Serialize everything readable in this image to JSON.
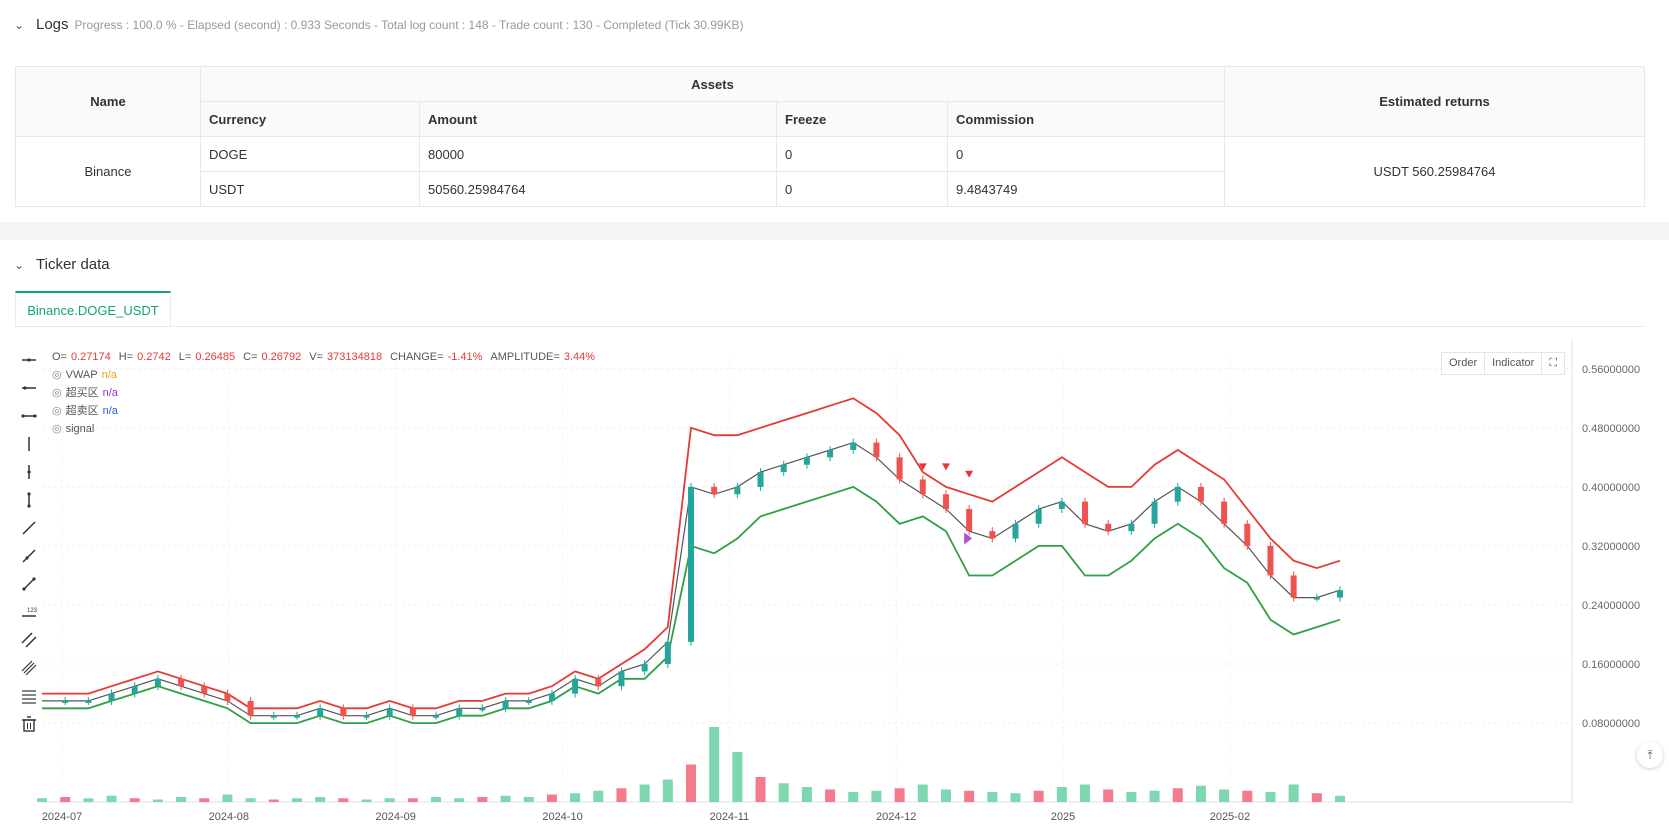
{
  "logs": {
    "title": "Logs",
    "meta": "Progress : 100.0 % - Elapsed (second) : 0.933   Seconds - Total log count : 148 - Trade count : 130 - Completed (Tick 30.99KB)"
  },
  "assets_table": {
    "name_header": "Name",
    "assets_header": "Assets",
    "returns_header": "Estimated returns",
    "columns": [
      "Currency",
      "Amount",
      "Freeze",
      "Commission"
    ],
    "exchange": "Binance",
    "rows": [
      {
        "currency": "DOGE",
        "amount": "80000",
        "freeze": "0",
        "commission": "0"
      },
      {
        "currency": "USDT",
        "amount": "50560.25984764",
        "freeze": "0",
        "commission": "9.4843749"
      }
    ],
    "estimated_returns": "USDT 560.25984764"
  },
  "ticker": {
    "title": "Ticker data",
    "tab": "Binance.DOGE_USDT"
  },
  "legend": {
    "ohlc": [
      {
        "label": "O=",
        "value": "0.27174"
      },
      {
        "label": "H=",
        "value": "0.2742"
      },
      {
        "label": "L=",
        "value": "0.26485"
      },
      {
        "label": "C=",
        "value": "0.26792"
      },
      {
        "label": "V=",
        "value": "373134818"
      },
      {
        "label": "CHANGE=",
        "value": "-1.41%"
      },
      {
        "label": "AMPLITUDE=",
        "value": "3.44%"
      }
    ],
    "indicators": [
      {
        "name": "VWAP",
        "value": "n/a",
        "color": "#f59e0b"
      },
      {
        "name": "超买区",
        "value": "n/a",
        "color": "#9333ea"
      },
      {
        "name": "超卖区",
        "value": "n/a",
        "color": "#2563eb"
      },
      {
        "name": "signal",
        "value": "",
        "color": "#555555"
      }
    ]
  },
  "chart_buttons": {
    "order": "Order",
    "indicator": "Indicator"
  },
  "chart_data": {
    "type": "line",
    "title": "",
    "x_ticks": [
      "2024-07",
      "2024-08",
      "2024-09",
      "2024-10",
      "2024-11",
      "2024-12",
      "2025",
      "2025-02"
    ],
    "y_ticks": [
      "0.56000000",
      "0.48000000",
      "0.40000000",
      "0.32000000",
      "0.24000000",
      "0.16000000",
      "0.08000000"
    ],
    "ylim": [
      0.03,
      0.58
    ],
    "series": [
      {
        "color": "#e53935",
        "values": [
          0.12,
          0.12,
          0.12,
          0.13,
          0.14,
          0.15,
          0.14,
          0.13,
          0.12,
          0.1,
          0.1,
          0.1,
          0.11,
          0.1,
          0.1,
          0.11,
          0.1,
          0.1,
          0.11,
          0.11,
          0.12,
          0.12,
          0.13,
          0.15,
          0.14,
          0.16,
          0.18,
          0.21,
          0.48,
          0.47,
          0.47,
          0.48,
          0.49,
          0.5,
          0.51,
          0.52,
          0.5,
          0.47,
          0.42,
          0.4,
          0.39,
          0.38,
          0.4,
          0.42,
          0.44,
          0.42,
          0.4,
          0.4,
          0.43,
          0.45,
          0.43,
          0.41,
          0.37,
          0.33,
          0.3,
          0.29,
          0.3
        ]
      },
      {
        "color": "#555555",
        "values": [
          0.11,
          0.11,
          0.11,
          0.12,
          0.13,
          0.14,
          0.13,
          0.12,
          0.11,
          0.09,
          0.09,
          0.09,
          0.1,
          0.09,
          0.09,
          0.1,
          0.09,
          0.09,
          0.1,
          0.1,
          0.11,
          0.11,
          0.12,
          0.14,
          0.13,
          0.15,
          0.16,
          0.19,
          0.4,
          0.39,
          0.4,
          0.42,
          0.43,
          0.44,
          0.45,
          0.46,
          0.44,
          0.41,
          0.39,
          0.37,
          0.34,
          0.33,
          0.35,
          0.37,
          0.38,
          0.35,
          0.34,
          0.35,
          0.38,
          0.4,
          0.38,
          0.35,
          0.32,
          0.28,
          0.25,
          0.25,
          0.26
        ]
      },
      {
        "color": "#2ea043",
        "values": [
          0.1,
          0.1,
          0.1,
          0.11,
          0.12,
          0.13,
          0.12,
          0.11,
          0.1,
          0.08,
          0.08,
          0.08,
          0.09,
          0.08,
          0.08,
          0.09,
          0.08,
          0.08,
          0.09,
          0.09,
          0.1,
          0.1,
          0.11,
          0.13,
          0.12,
          0.14,
          0.14,
          0.17,
          0.32,
          0.31,
          0.33,
          0.36,
          0.37,
          0.38,
          0.39,
          0.4,
          0.38,
          0.35,
          0.36,
          0.34,
          0.28,
          0.28,
          0.3,
          0.32,
          0.32,
          0.28,
          0.28,
          0.3,
          0.33,
          0.35,
          0.33,
          0.29,
          0.27,
          0.22,
          0.2,
          0.21,
          0.22
        ]
      }
    ],
    "volume": [
      3,
      4,
      3,
      5,
      3,
      2,
      4,
      3,
      6,
      3,
      2,
      3,
      4,
      3,
      2,
      3,
      3,
      4,
      3,
      4,
      5,
      4,
      6,
      7,
      9,
      11,
      14,
      18,
      30,
      60,
      40,
      20,
      15,
      12,
      10,
      8,
      9,
      11,
      14,
      10,
      9,
      8,
      7,
      9,
      12,
      14,
      10,
      8,
      9,
      11,
      13,
      10,
      9,
      8,
      14,
      7,
      5
    ]
  }
}
